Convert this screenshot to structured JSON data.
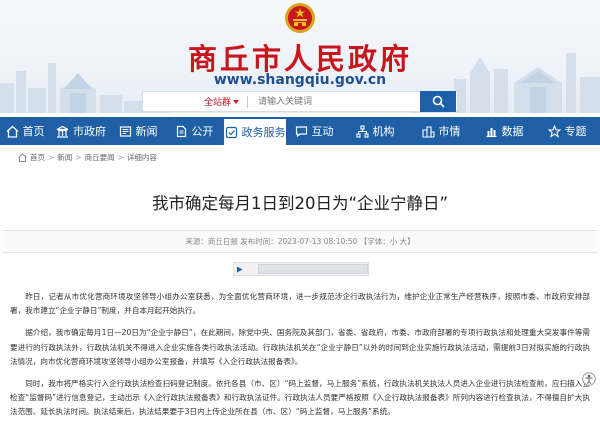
{
  "header": {
    "site_title": "商丘市人民政府",
    "site_url": "www.shangqiu.gov.cn"
  },
  "search": {
    "scope": "全站群",
    "placeholder": "请输入关键词"
  },
  "nav": [
    {
      "label": "首页",
      "icon": "home-icon"
    },
    {
      "label": "市政府",
      "icon": "government-building-icon"
    },
    {
      "label": "新闻",
      "icon": "newspaper-icon"
    },
    {
      "label": "公开",
      "icon": "document-icon"
    },
    {
      "label": "政务服务",
      "icon": "service-icon",
      "active": true
    },
    {
      "label": "互动",
      "icon": "chat-icon"
    },
    {
      "label": "机构",
      "icon": "organization-icon"
    },
    {
      "label": "市情",
      "icon": "city-icon"
    },
    {
      "label": "数据",
      "icon": "chart-icon"
    },
    {
      "label": "专题",
      "icon": "topic-icon"
    }
  ],
  "breadcrumb": [
    "首页",
    "新闻",
    "商丘要闻",
    "详细内容"
  ],
  "article": {
    "title": "我市确定每月1日到20日为“企业宁静日”",
    "meta": "来源：商丘日报    发布时间：2023-07-13 08:10:50    【字体：小 大】",
    "paragraphs": [
      "昨日，记者从市优化营商环境攻坚领导小组办公室获悉，为全面优化营商环境，进一步规范涉企行政执法行为，维护企业正常生产经营秩序，按照市委、市政府安排部署，我市建立“企业宁静日”制度，并自本月起开始执行。",
      "据介绍，我市确定每月1日—20日为“企业宁静日”，在此期间，除党中央、国务院及其部门，省委、省政府，市委、市政府部署的专项行政执法和处理重大突发事件等需要进行的行政执法外，行政执法机关不得进入企业实施各类行政执法活动。行政执法机关在“企业宁静日”以外的时间到企业实施行政执法活动，需提前3日对拟实施的行政执法情况，向市优化营商环境攻坚领导小组办公室报备，并填写《入企行政执法报备表》。",
      "同时，我市将严格实行入企行政执法检查扫码登记制度。依托各县（市、区）“码上监督，马上服务”系统，行政执法机关执法人员进入企业进行执法检查前，应扫描入企检查“监督码”进行信息登记，主动出示《入企行政执法报备表》和行政执法证件。行政执法人员要严格按照《入企行政执法报备表》所列内容进行检查执法，不得擅自扩大执法范围、延长执法时间。执法结束后，执法结果要于3日内上传企业所在县（市、区）“码上监督，马上服务”系统。"
    ]
  },
  "colors": {
    "brand_red": "#c8161d",
    "nav_blue": "#1e5fa6"
  }
}
